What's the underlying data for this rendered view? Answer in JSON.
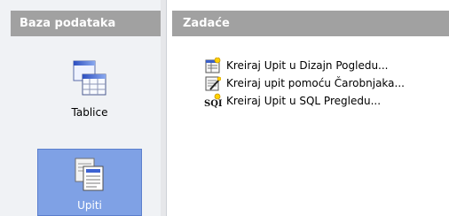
{
  "left_panel": {
    "title": "Baza podataka",
    "items": [
      {
        "label": "Tablice",
        "icon": "table-icon",
        "selected": false
      },
      {
        "label": "Upiti",
        "icon": "query-icon",
        "selected": true
      }
    ]
  },
  "right_panel": {
    "title": "Zadaće",
    "tasks": [
      {
        "label": "Kreiraj Upit u Dizajn Pogledu...",
        "icon": "design-view-icon"
      },
      {
        "label": "Kreiraj upit pomoću Čarobnjaka...",
        "icon": "wizard-icon"
      },
      {
        "label": "Kreiraj Upit u SQL Pregledu...",
        "icon": "sql-icon"
      }
    ]
  },
  "colors": {
    "header_bg": "#a1a1a1",
    "panel_bg": "#f0f2f5",
    "selected_bg": "#7fa1e5"
  }
}
